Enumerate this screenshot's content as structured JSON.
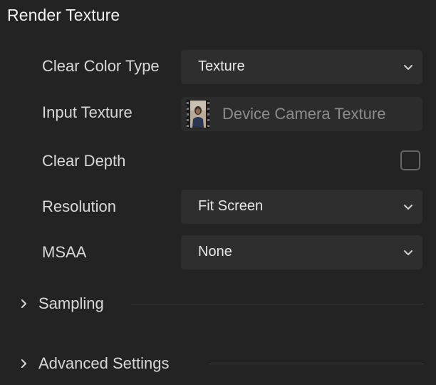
{
  "section": {
    "title": "Render Texture"
  },
  "fields": {
    "clear_color_type": {
      "label": "Clear Color Type",
      "value": "Texture"
    },
    "input_texture": {
      "label": "Input Texture",
      "value": "Device Camera Texture"
    },
    "clear_depth": {
      "label": "Clear Depth",
      "checked": false
    },
    "resolution": {
      "label": "Resolution",
      "value": "Fit Screen"
    },
    "msaa": {
      "label": "MSAA",
      "value": "None"
    }
  },
  "groups": [
    {
      "label": "Sampling",
      "expanded": false
    },
    {
      "label": "Advanced Settings",
      "expanded": false
    }
  ],
  "icons": {
    "dropdown": "chevron-down-icon",
    "group_toggle": "chevron-right-icon",
    "texture_thumbnail": "camera-texture-thumbnail"
  },
  "colors": {
    "background": "#232323",
    "field_background": "#2e2e2e",
    "placeholder_text": "#8c8c8c"
  }
}
